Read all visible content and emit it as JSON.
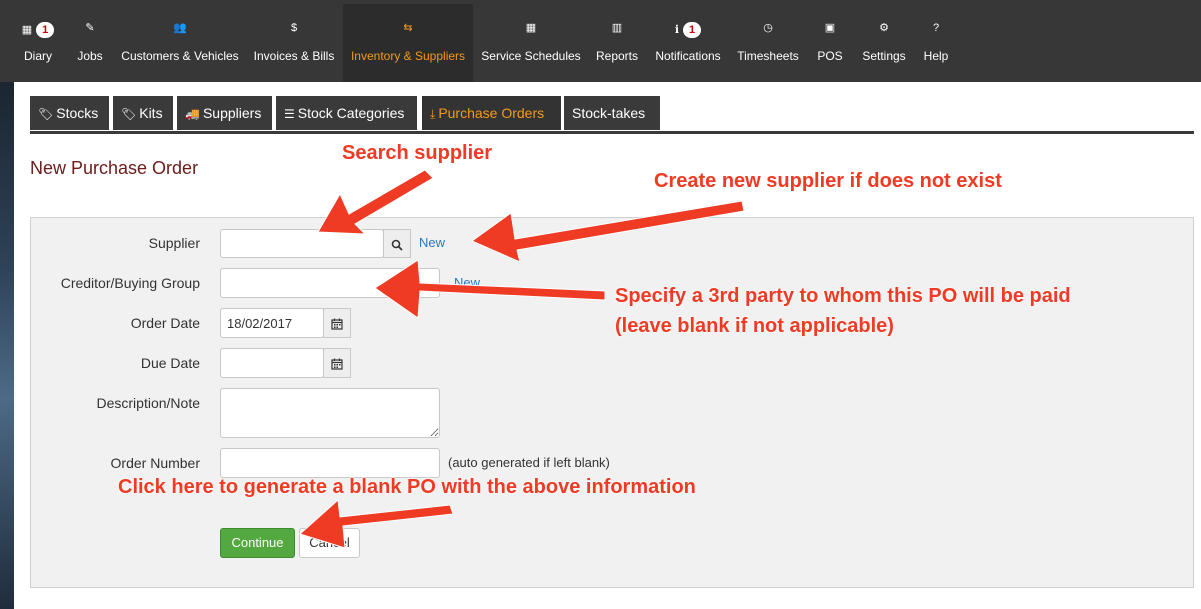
{
  "nav": {
    "items": [
      {
        "label": "Diary",
        "icon": "calendar-icon",
        "badge": "1"
      },
      {
        "label": "Jobs",
        "icon": "wrench-icon"
      },
      {
        "label": "Customers & Vehicles",
        "icon": "users-icon"
      },
      {
        "label": "Invoices & Bills",
        "icon": "dollar-icon"
      },
      {
        "label": "Inventory & Suppliers",
        "icon": "exchange-icon",
        "active": true
      },
      {
        "label": "Service Schedules",
        "icon": "calendar-icon"
      },
      {
        "label": "Reports",
        "icon": "bar-chart-icon"
      },
      {
        "label": "Notifications",
        "icon": "info-icon",
        "badge": "1"
      },
      {
        "label": "Timesheets",
        "icon": "clock-icon"
      },
      {
        "label": "POS",
        "icon": "pos-icon"
      },
      {
        "label": "Settings",
        "icon": "gears-icon"
      },
      {
        "label": "Help",
        "icon": "question-icon"
      }
    ],
    "icons": {
      "calendar": "▦",
      "wrench": "✎",
      "users": "👥",
      "dollar": "$",
      "exchange": "⇆",
      "chart": "▥",
      "info": "ℹ",
      "clock": "◷",
      "pos": "▣",
      "gears": "⚙",
      "question": "?"
    }
  },
  "tabs": [
    {
      "label": "Stocks",
      "icon": "tag-icon",
      "glyph": "🏷"
    },
    {
      "label": "Kits",
      "icon": "tag-icon",
      "glyph": "🏷"
    },
    {
      "label": "Suppliers",
      "icon": "truck-icon",
      "glyph": "🚚"
    },
    {
      "label": "Stock Categories",
      "icon": "list-icon",
      "glyph": "☰"
    },
    {
      "label": "Purchase Orders",
      "icon": "download-icon",
      "glyph": "⤓",
      "active": true
    },
    {
      "label": "Stock-takes"
    }
  ],
  "page": {
    "title": "New Purchase Order"
  },
  "form": {
    "supplier_label": "Supplier",
    "supplier_value": "",
    "new_label": "New",
    "creditor_label": "Creditor/Buying Group",
    "order_date_label": "Order Date",
    "order_date_value": "18/02/2017",
    "due_date_label": "Due Date",
    "due_date_value": "",
    "description_label": "Description/Note",
    "order_number_label": "Order Number",
    "order_number_help": "(auto generated if left blank)",
    "continue_label": "Continue",
    "cancel_label": "Cancel"
  },
  "annotations": {
    "search_supplier": "Search supplier",
    "create_supplier": "Create new supplier if does not exist",
    "third_party_line1": "Specify a 3rd party to whom this PO will be paid",
    "third_party_line2": "(leave blank if not applicable)",
    "generate_po": "Click here to generate a blank PO with the above information",
    "color": "#ef3a24"
  }
}
